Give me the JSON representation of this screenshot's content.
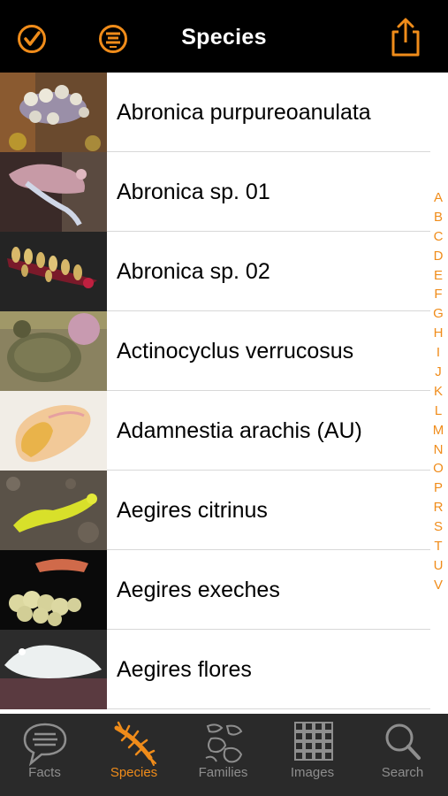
{
  "navbar": {
    "title": "Species",
    "left_buttons": [
      "checkmark-circle-icon",
      "filter-list-icon"
    ],
    "right_button": "share-icon"
  },
  "species": [
    {
      "name": "Abronica purpureoanulata"
    },
    {
      "name": "Abronica sp. 01"
    },
    {
      "name": "Abronica sp. 02"
    },
    {
      "name": "Actinocyclus verrucosus"
    },
    {
      "name": "Adamnestia arachis (AU)"
    },
    {
      "name": "Aegires citrinus"
    },
    {
      "name": "Aegires exeches"
    },
    {
      "name": "Aegires flores"
    }
  ],
  "index_letters": [
    "A",
    "B",
    "C",
    "D",
    "E",
    "F",
    "G",
    "H",
    "I",
    "J",
    "K",
    "L",
    "M",
    "N",
    "O",
    "P",
    "R",
    "S",
    "T",
    "U",
    "V"
  ],
  "tabs": [
    {
      "label": "Facts",
      "icon": "speech-bubble-icon",
      "active": false
    },
    {
      "label": "Species",
      "icon": "nudibranch-icon",
      "active": true
    },
    {
      "label": "Families",
      "icon": "families-icon",
      "active": false
    },
    {
      "label": "Images",
      "icon": "grid-icon",
      "active": false
    },
    {
      "label": "Search",
      "icon": "search-icon",
      "active": false
    }
  ],
  "colors": {
    "accent": "#f08c1a",
    "navbar_bg": "#000000",
    "tabbar_bg": "#2a2a2a",
    "tab_inactive": "#8e8e8e"
  }
}
